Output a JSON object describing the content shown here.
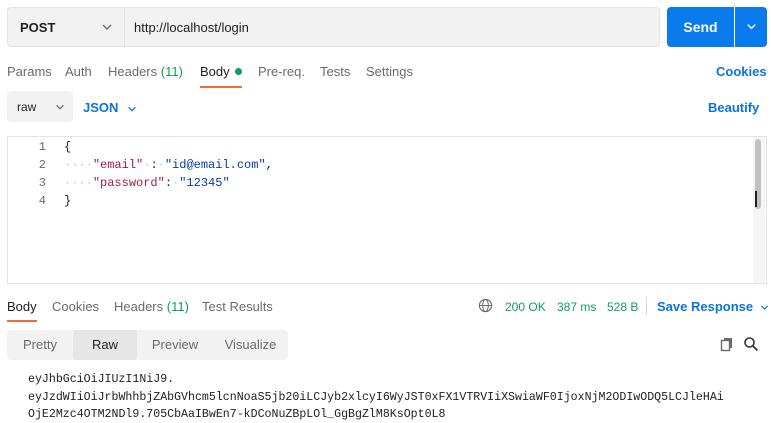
{
  "request": {
    "method": "POST",
    "url": "http://localhost/login",
    "send_label": "Send"
  },
  "request_tabs": [
    {
      "label": "Params"
    },
    {
      "label": "Auth"
    },
    {
      "label": "Headers",
      "count": "(11)"
    },
    {
      "label": "Body"
    },
    {
      "label": "Pre-req."
    },
    {
      "label": "Tests"
    },
    {
      "label": "Settings"
    }
  ],
  "cookies_link": "Cookies",
  "body_options": {
    "mode": "raw",
    "language": "JSON",
    "beautify": "Beautify"
  },
  "editor": {
    "line_numbers": [
      "1",
      "2",
      "3",
      "4"
    ],
    "lines": {
      "open": "{",
      "email_key": "\"email\"",
      "email_value": "\"id@email.com\"",
      "password_key": "\"password\"",
      "password_value": "\"12345\"",
      "close": "}"
    }
  },
  "response_tabs": [
    {
      "label": "Body"
    },
    {
      "label": "Cookies"
    },
    {
      "label": "Headers",
      "count": "(11)"
    },
    {
      "label": "Test Results"
    }
  ],
  "response_meta": {
    "status": "200 OK",
    "time": "387 ms",
    "size": "528 B",
    "save_label": "Save Response"
  },
  "view_modes": [
    "Pretty",
    "Raw",
    "Preview",
    "Visualize"
  ],
  "response_body": [
    "eyJhbGciOiJIUzI1NiJ9.",
    "eyJzdWIiOiJrbWhhbjZAbGVhcm5lcnNoaS5jb20iLCJyb2xlcyI6WyJST0xFX1VTRVIiXSwiaWF0IjoxNjM2ODIwODQ5LCJleHAi",
    "OjE2Mzc4OTM2NDl9.705CbAaIBwEn7-kDCoNuZBpLOl_GgBgZlM8KsOpt0L8"
  ],
  "colors": {
    "accent": "#097bed",
    "active_tab_underline": "#f26b3a",
    "success": "#0f9d58"
  }
}
